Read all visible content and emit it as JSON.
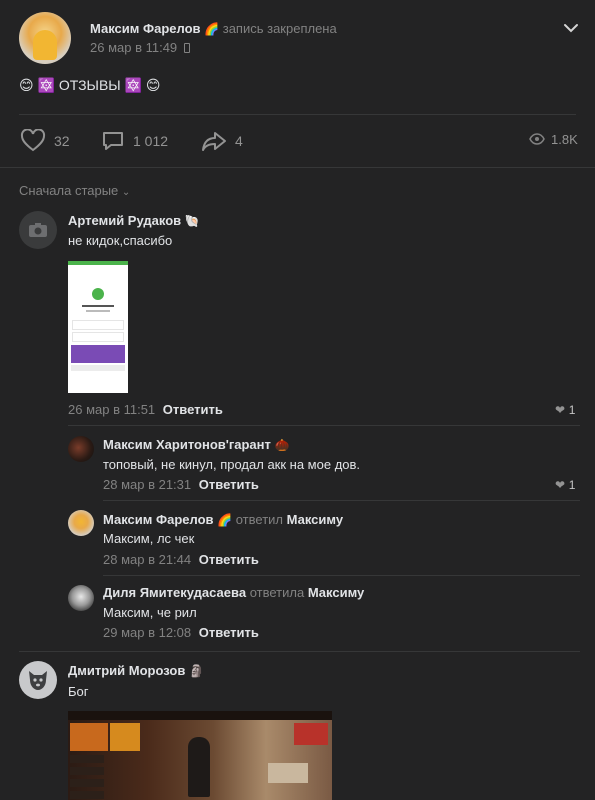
{
  "post": {
    "author": "Максим Фарелов",
    "author_emoji": "🌈",
    "pinned_text": "запись закреплена",
    "date": "26 мар в 11:49",
    "text_prefix": "😊 🔯",
    "text_title": "ОТЗЫВЫ",
    "text_suffix": "🔯 😊",
    "likes": "32",
    "comments": "1 012",
    "shares": "4",
    "views": "1.8K"
  },
  "comments_sort": "Сначала старые",
  "comments": [
    {
      "author": "Артемий Рудаков",
      "author_emoji": "🐚",
      "text": "не кидок,спасибо",
      "date": "26 мар в 11:51",
      "reply_label": "Ответить",
      "likes": "1"
    },
    {
      "author": "Максим Харитонов'гарант",
      "author_emoji": "🌰",
      "text": "топовый, не кинул, продал акк на мое дов.",
      "date": "28 мар в 21:31",
      "reply_label": "Ответить",
      "likes": "1"
    },
    {
      "author": "Максим Фарелов",
      "author_emoji": "🌈",
      "replied_word": "ответил",
      "replied_to": "Максиму",
      "text": "Максим, лс чек",
      "date": "28 мар в 21:44",
      "reply_label": "Ответить"
    },
    {
      "author": "Диля Ямитекудасаева",
      "replied_word": "ответила",
      "replied_to": "Максиму",
      "text": "Максим, че рил",
      "date": "29 мар в 12:08",
      "reply_label": "Ответить"
    },
    {
      "author": "Дмитрий Морозов",
      "author_emoji": "🗿",
      "text": "Бог"
    }
  ]
}
